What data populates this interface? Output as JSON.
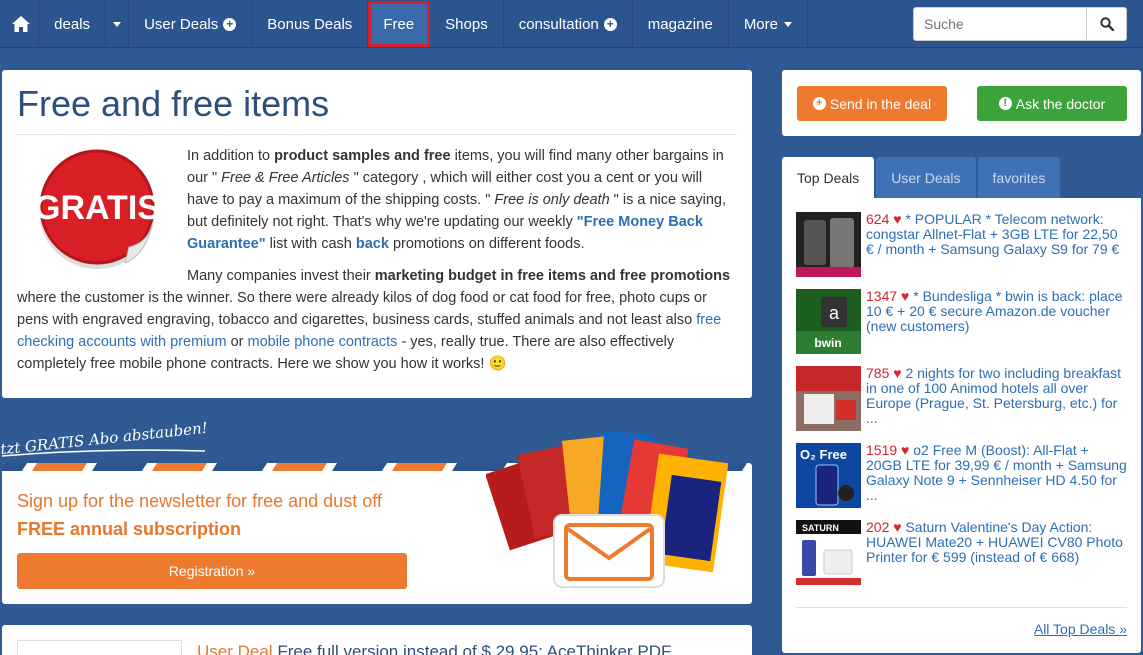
{
  "nav": {
    "items": [
      {
        "label": "deals"
      },
      {
        "label": "User Deals"
      },
      {
        "label": "Bonus Deals"
      },
      {
        "label": "Free"
      },
      {
        "label": "Shops"
      },
      {
        "label": "consultation"
      },
      {
        "label": "magazine"
      },
      {
        "label": "More"
      }
    ],
    "search_placeholder": "Suche"
  },
  "intro": {
    "title": "Free and free items",
    "logo_text": "GRATIS",
    "p1_a": "In addition to ",
    "p1_b": "product samples and free",
    "p1_c": " items, you will find many other bargains in our \" ",
    "p1_d": "Free & Free Articles",
    "p1_e": " \" category , which will either cost you a cent or you will have to pay a maximum of the shipping costs. \" ",
    "p1_f": "Free is only death",
    "p1_g": " \" is a nice saying, but definitely not right. That's why we're updating our weekly ",
    "p1_h": "\"Free Money Back Guarantee\"",
    "p1_i": " list   with cash ",
    "p1_j": "back",
    "p1_k": " promotions on different foods.",
    "p2_a": "Many companies invest their ",
    "p2_b": "marketing budget in free items and free promotions",
    "p2_c": " where the customer is the winner. So there were already kilos of dog food or cat food for free, photo cups or pens with engraved engraving, tobacco and cigarettes, business cards, stuffed animals and not least also ",
    "p2_d": "free checking accounts with premium",
    "p2_e": " or ",
    "p2_f": "mobile phone contracts",
    "p2_g": " - yes, really true. There are also effectively completely free mobile phone contracts. Here we show you how it works! 🙂"
  },
  "newsletter": {
    "tag": "tzt GRATIS Abo abstauben!",
    "title": "Sign up for the newsletter for free and dust off",
    "subtitle": "FREE annual subscription",
    "button": "Registration »"
  },
  "user_deal": {
    "tag": "User Deal",
    "title": "Free full version instead of $ 29.95: AceThinker PDF"
  },
  "sidebar": {
    "send_label": "Send in the deal",
    "ask_label": "Ask the doctor",
    "tabs": [
      "Top Deals",
      "User Deals",
      "favorites"
    ],
    "deals": [
      {
        "score": "624",
        "text": "* POPULAR * Telecom network: congstar Allnet-Flat + 3GB LTE for 22,50 € / month + Samsung Galaxy S9 for 79 €"
      },
      {
        "score": "1347",
        "text": "* Bundesliga * bwin is back: place 10 € + 20 € secure Amazon.de voucher (new customers)"
      },
      {
        "score": "785",
        "text": "2 nights for two including breakfast in one of 100 Animod hotels all over Europe (Prague, St. Petersburg, etc.) for ..."
      },
      {
        "score": "1519",
        "text": "o2 Free M (Boost): All-Flat + 20GB LTE for 39,99 € / month + Samsung Galaxy Note 9 + Sennheiser HD 4.50 for ..."
      },
      {
        "score": "202",
        "text": "Saturn Valentine's Day Action: HUAWEI Mate20 + HUAWEI CV80 Photo Printer for € 599 (instead of € 668)"
      }
    ],
    "all_top": "All Top Deals »"
  },
  "colors": {
    "nav_bg": "#2c5590",
    "accent_orange": "#ee7a2f",
    "accent_green": "#3ca33a",
    "score_red": "#d9232d",
    "link_blue": "#2c6fb5"
  }
}
